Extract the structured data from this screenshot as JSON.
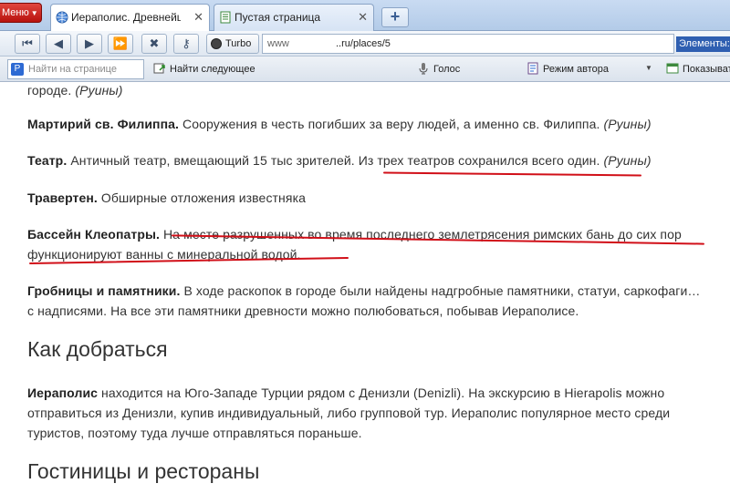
{
  "browser": {
    "menu_label": "Меню",
    "tabs": [
      {
        "title": "Иераполис. Древнейши",
        "close": "✕"
      },
      {
        "title": "Пустая страница",
        "close": "✕"
      }
    ],
    "newtab_label": "+",
    "turbo_label": "Turbo",
    "address": {
      "prefix": "www",
      "value": "..ru/places/5"
    },
    "elements_label": "Элементы:"
  },
  "toolbar": {
    "find_placeholder": "Найти на странице",
    "find_next": "Найти следующее",
    "voice": "Голос",
    "author_mode": "Режим автора",
    "show": "Показыват"
  },
  "content": {
    "p0_tail": "городе.",
    "p0_tag": "(Руины)",
    "martyr_bold": "Мартирий св. Филиппа.",
    "martyr_text": " Сооружения в честь погибших за веру людей, а именно св. Филиппа. ",
    "martyr_tag": "(Руины)",
    "theater_bold": "Театр.",
    "theater_text": " Античный театр, вмещающий 15 тыс зрителей. Из трех театров сохранился всего один. ",
    "theater_tag": "(Руины)",
    "travertine_bold": "Травертен.",
    "travertine_text": " Обширные отложения известняка",
    "pool_bold": "Бассейн Клеопатры.",
    "pool_text": " На месте разрушенных во время последнего землетрясения римских бань до сих пор функционируют ванны с минеральной водой.",
    "tombs_bold": "Гробницы и памятники.",
    "tombs_text": " В ходе раскопок в городе были найдены надгробные памятники, статуи, саркофаги… с надписями. На все эти памятники древности можно полюбоваться, побывав Иераполисе.",
    "heading_how": "Как добраться",
    "how_bold": "Иераполис",
    "how_text": " находится на Юго-Западе Турции рядом с Денизли (Denizli). На экскурсию в Hierapolis можно отправиться из Денизли, купив индивидуальный, либо групповой тур. Иераполис популярное место среди туристов, поэтому туда лучше отправляться пораньше.",
    "heading_hotels": "Гостиницы и рестораны"
  },
  "colors": {
    "annotation_red": "#d10f18",
    "menu_red": "#c0201a"
  }
}
